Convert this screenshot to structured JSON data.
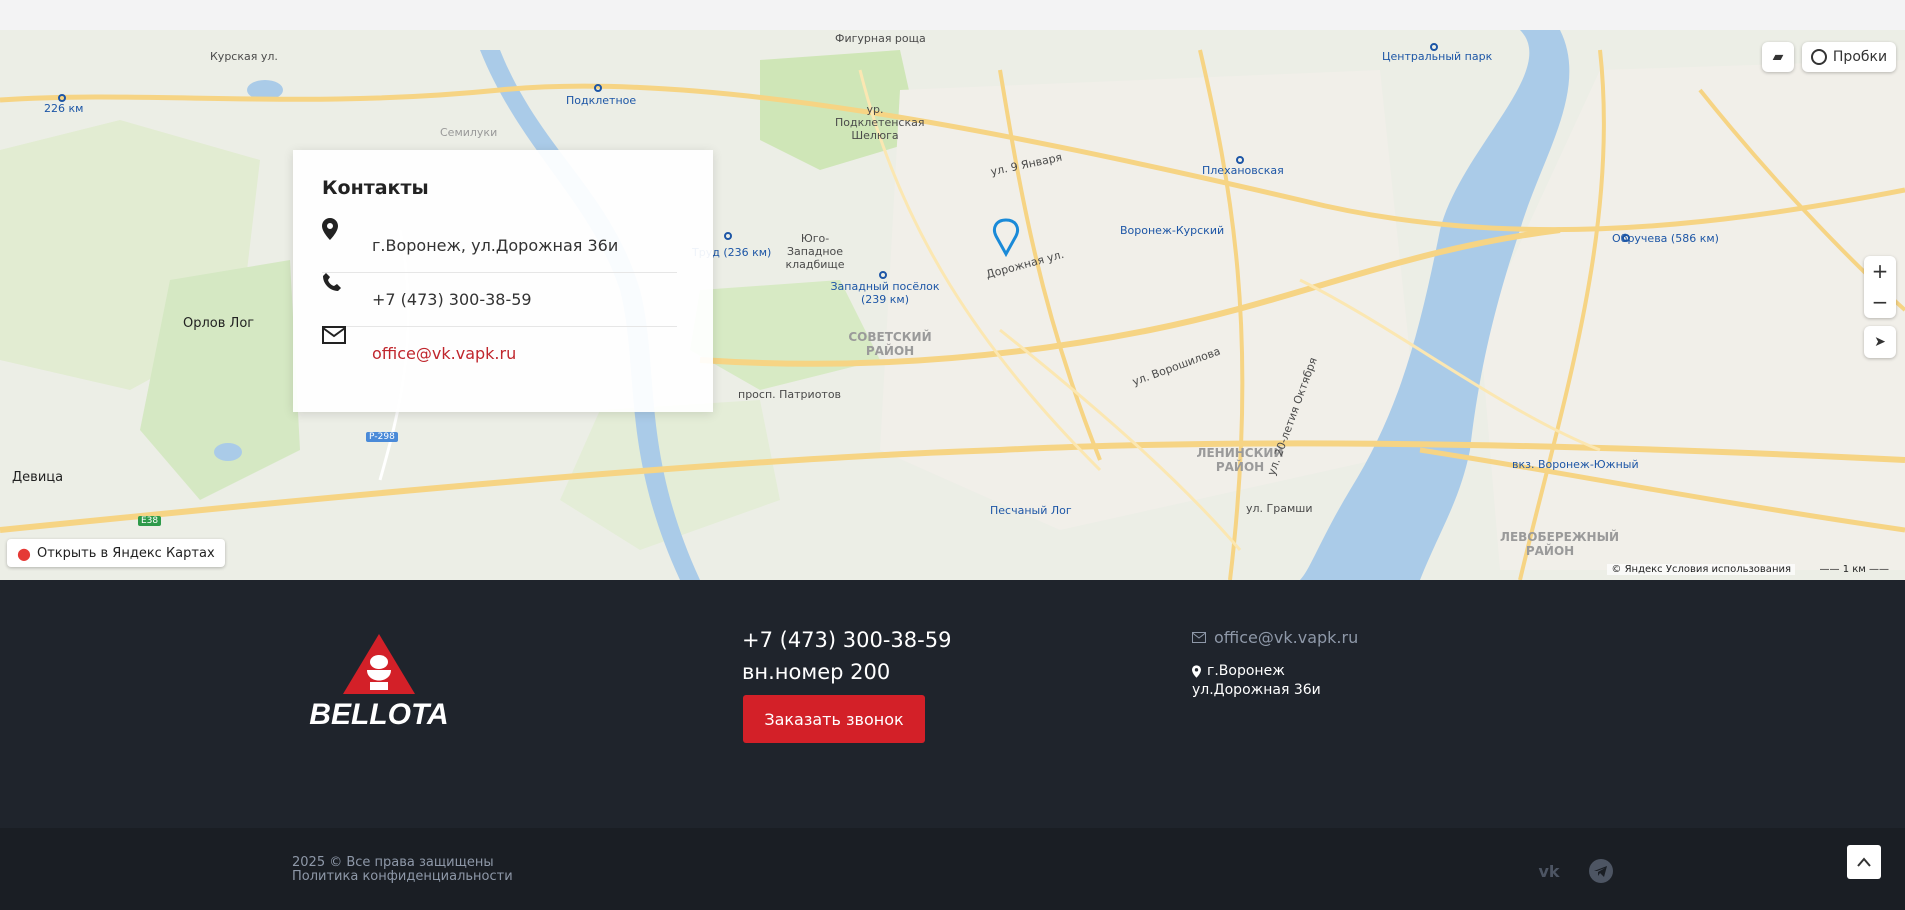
{
  "map": {
    "open_link": "Открыть в Яндекс Картах",
    "traffic": "Пробки",
    "zoom_in": "+",
    "zoom_out": "−",
    "copyright": "© Яндекс  Условия использования",
    "scale": "1 км",
    "labels": {
      "l1": "Курская ул.",
      "l2": "226 км",
      "l3": "Подклетное",
      "l4": "Семилуки",
      "l5": "Фигурная роща",
      "l6": "ур. Подклетенская Шелюга",
      "l7": "Юго-Западное кладбище",
      "l8": "Труд (236 км)",
      "l9": "Западный посёлок (239 км)",
      "l10": "СОВЕТСКИЙ РАЙОН",
      "l11": "Орлов Лог",
      "l12": "Девица",
      "l13": "Плехановская",
      "l14": "Воронеж-Курский",
      "l15": "Центральный парк",
      "l16": "Обручева (586 км)",
      "l17": "ЛЕНИНСКИЙ РАЙОН",
      "l18": "вкз. Воронеж-Южный",
      "l19": "ЛЕВОБЕРЕЖНЫЙ РАЙОН",
      "l20": "ул. Грамши",
      "l21": "просп. Патриотов",
      "l22": "Дорожная ул.",
      "l23": "Песчаный Лог",
      "l24": "Р-298",
      "l25": "E38",
      "l26": "ул. 9 Января",
      "l27": "ул. Ворошилова",
      "l28": "ул. 20-летия Октября"
    }
  },
  "contacts": {
    "title": "Контакты",
    "address": "г.Воронеж, ул.Дорожная 36и",
    "phone": "+7 (473) 300-38-59",
    "email": "office@vk.vapk.ru"
  },
  "footer": {
    "logo_text": "BELLOTA",
    "phone": "+7 (473) 300-38-59",
    "ext": "вн.номер 200",
    "callback_label": "Заказать звонок",
    "email": "office@vk.vapk.ru",
    "address_line1": "г.Воронеж",
    "address_line2": "ул.Дорожная 36и"
  },
  "bottom": {
    "copyright": "2025 © Все права защищены",
    "privacy": "Политика конфиденциальности"
  },
  "colors": {
    "accent": "#d32028",
    "footer_bg": "#1f242c",
    "link_red": "#c0262d",
    "water": "#aacbe8",
    "park": "#cde6b8"
  }
}
